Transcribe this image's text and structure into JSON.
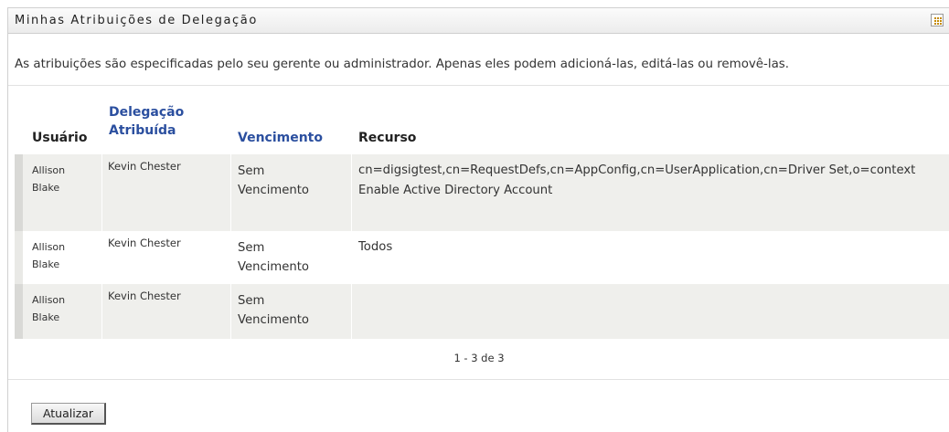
{
  "panel": {
    "title": "Minhas Atribuições de Delegação",
    "description": "As atribuições são especificadas pelo seu gerente ou administrador. Apenas eles podem adicioná-las, editá-las ou removê-las."
  },
  "table": {
    "headers": {
      "user": "Usuário",
      "delegation_line1": "Delegação",
      "delegation_line2": "Atribuída",
      "expiry": "Vencimento",
      "resource": "Recurso"
    },
    "rows": [
      {
        "user": "Allison Blake",
        "delegate": "Kevin Chester",
        "expiry": "Sem Vencimento",
        "resource_line1": "cn=digsigtest,cn=RequestDefs,cn=AppConfig,cn=UserApplication,cn=Driver Set,o=context",
        "resource_line2": "Enable Active Directory Account"
      },
      {
        "user": "Allison Blake",
        "delegate": "Kevin Chester",
        "expiry": "Sem Vencimento",
        "resource_line1": "Todos",
        "resource_line2": ""
      },
      {
        "user": "Allison Blake",
        "delegate": "Kevin Chester",
        "expiry": "Sem Vencimento",
        "resource_line1": "",
        "resource_line2": ""
      }
    ],
    "pagination": "1 - 3 de 3"
  },
  "actions": {
    "refresh_label": "Atualizar"
  },
  "icons": {
    "panel_options": "grid-menu-icon"
  }
}
